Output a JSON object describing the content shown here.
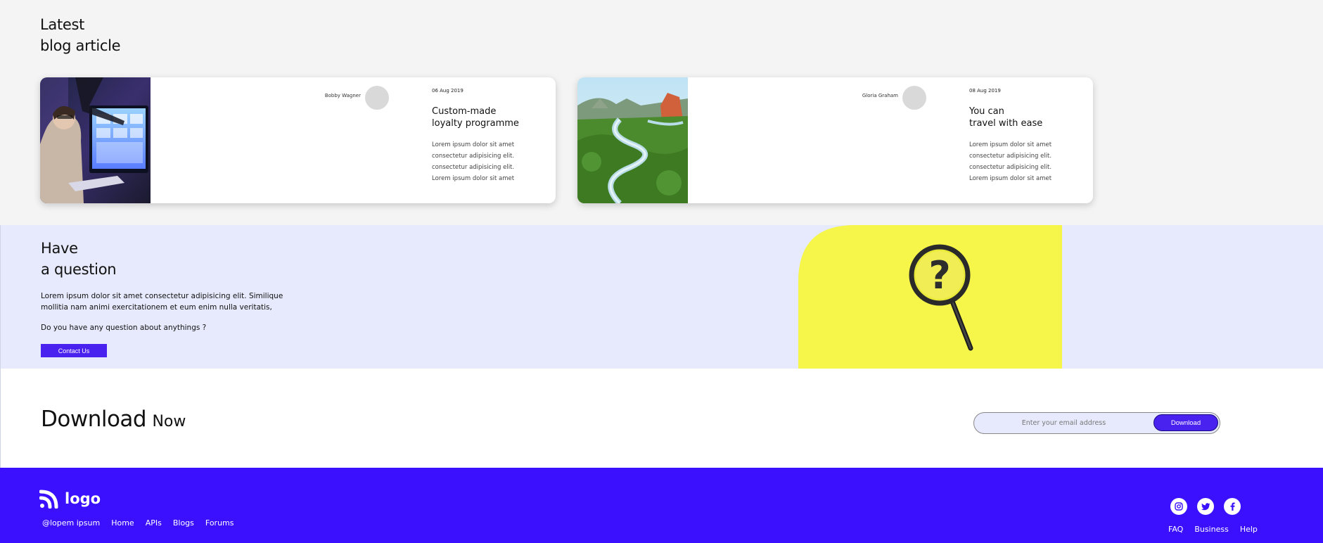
{
  "blog": {
    "title_line1": "Latest",
    "title_line2": "blog article",
    "cards": [
      {
        "author": "Bobby Wagner",
        "date": "06 Aug 2019",
        "heading_line1": "Custom-made",
        "heading_line2": "loyalty programme",
        "excerpt": [
          "Lorem ipsum dolor sit amet",
          "consectetur adipisicing elit.",
          "consectetur adipisicing elit.",
          "Lorem ipsum dolor sit amet"
        ]
      },
      {
        "author": "Gloria Graham",
        "date": "08 Aug 2019",
        "heading_line1": "You can",
        "heading_line2": "travel with ease",
        "excerpt": [
          "Lorem ipsum dolor sit amet",
          "consectetur adipisicing elit.",
          "consectetur adipisicing elit.",
          "Lorem ipsum dolor sit amet"
        ]
      }
    ]
  },
  "question": {
    "title_line1": "Have",
    "title_line2": "a question",
    "body": "Lorem ipsum dolor sit amet consectetur adipisicing elit. Similique mollitia nam animi exercitationem et eum enim nulla veritatis,",
    "ask": "Do you have any question about anythings ?",
    "contact_label": "Contact Us"
  },
  "download": {
    "title_main": "Download",
    "title_sub": "Now",
    "email_placeholder": "Enter your email address",
    "button_label": "Download"
  },
  "footer": {
    "logo_text": "logo",
    "links": [
      "@lopem ipsum",
      "Home",
      "APIs",
      "Blogs",
      "Forums"
    ],
    "social_icons": [
      "instagram-icon",
      "twitter-icon",
      "facebook-icon"
    ],
    "right_links": [
      "FAQ",
      "Business",
      "Help"
    ]
  },
  "colors": {
    "accent": "#4a22f0",
    "footer_bg": "#3a10ff",
    "question_bg": "#e7eafc",
    "yellow": "#f6f54a"
  }
}
